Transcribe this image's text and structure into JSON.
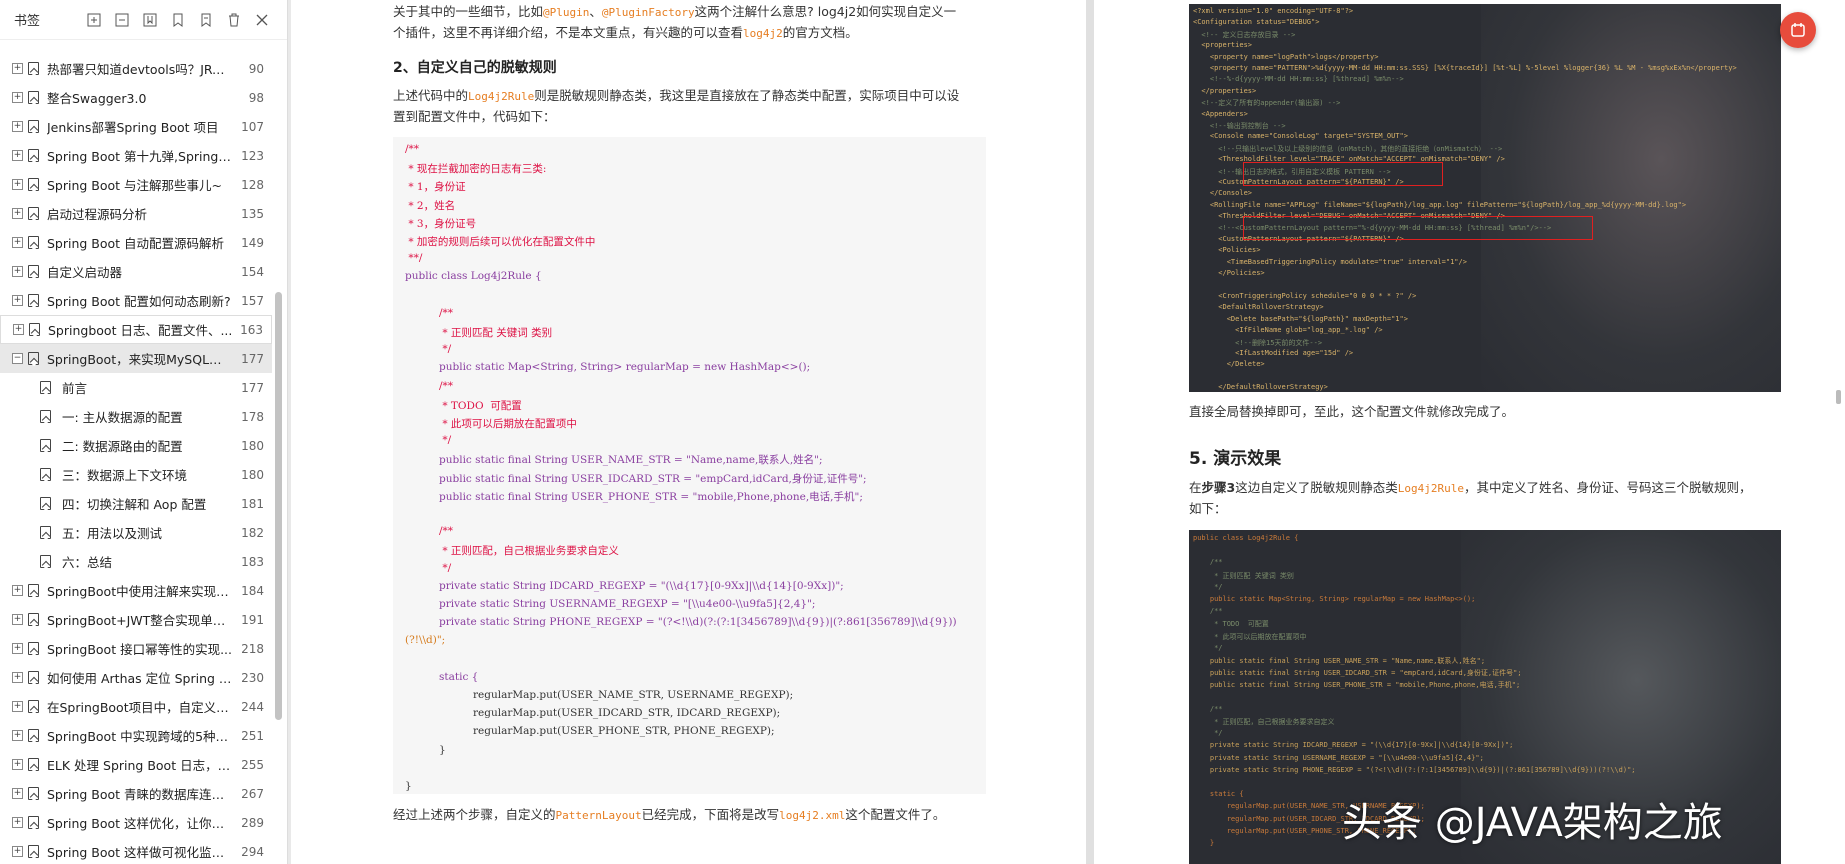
{
  "sidebar": {
    "title": "书签",
    "tools": [
      "expand-all-icon",
      "collapse-all-icon",
      "add-bookmark-icon",
      "bookmark-icon",
      "bookmark-outline-icon",
      "delete-icon",
      "close-icon"
    ],
    "items": [
      {
        "label": "热部署只知道devtools吗？JRebe...",
        "page": "90",
        "level": 0
      },
      {
        "label": "整合Swagger3.0",
        "page": "98",
        "level": 0
      },
      {
        "label": "Jenkins部署Spring Boot 项目",
        "page": "107",
        "level": 0
      },
      {
        "label": "Spring Boot 第十九弹,Spring B...",
        "page": "123",
        "level": 0
      },
      {
        "label": "Spring Boot 与注解那些事儿~",
        "page": "128",
        "level": 0
      },
      {
        "label": "启动过程源码分析",
        "page": "135",
        "level": 0
      },
      {
        "label": "Spring Boot 自动配置源码解析",
        "page": "149",
        "level": 0
      },
      {
        "label": "自定义启动器",
        "page": "154",
        "level": 0
      },
      {
        "label": "Spring Boot 配置如何动态刷新?",
        "page": "157",
        "level": 0
      },
      {
        "label": "Springboot 日志、配置文件、...",
        "page": "163",
        "level": 0
      },
      {
        "label": "SpringBoot，来实现MySQL读...",
        "page": "177",
        "level": 0
      },
      {
        "label": "前言",
        "page": "177",
        "level": 1
      },
      {
        "label": "一: 主从数据源的配置",
        "page": "178",
        "level": 1
      },
      {
        "label": "二: 数据源路由的配置",
        "page": "180",
        "level": 1
      },
      {
        "label": "三：数据源上下文环境",
        "page": "180",
        "level": 1
      },
      {
        "label": "四：切换注解和 Aop 配置",
        "page": "181",
        "level": 1
      },
      {
        "label": "五：用法以及测试",
        "page": "182",
        "level": 1
      },
      {
        "label": "六：总结",
        "page": "183",
        "level": 1
      },
      {
        "label": "SpringBoot中使用注解来实现 R...",
        "page": "184",
        "level": 0
      },
      {
        "label": "SpringBoot+JWT整合实现单点...",
        "page": "191",
        "level": 0
      },
      {
        "label": "SpringBoot 接口幂等性的实现...",
        "page": "218",
        "level": 0
      },
      {
        "label": "如何使用 Arthas 定位 Spring B...",
        "page": "230",
        "level": 0
      },
      {
        "label": "在SpringBoot项目中，自定义注...",
        "page": "244",
        "level": 0
      },
      {
        "label": "SpringBoot 中实现跨域的5种方式",
        "page": "251",
        "level": 0
      },
      {
        "label": "ELK 处理 Spring Boot 日志，妙...",
        "page": "255",
        "level": 0
      },
      {
        "label": "Spring Boot 青睐的数据库连接...",
        "page": "267",
        "level": 0
      },
      {
        "label": "Spring Boot 这样优化，让你的...",
        "page": "289",
        "level": 0
      },
      {
        "label": "Spring Boot 这样做可视化监控...",
        "page": "294",
        "level": 0
      }
    ]
  },
  "doc_left": {
    "p1a": "关于其中的一些细节，比如",
    "p1_hl1": "@Plugin",
    "p1_sep": "、",
    "p1_hl2": "@PluginFactory",
    "p1b": "这两个注解什么意思? log4j2如何实现自定义一",
    "p1c": "个插件，这里不再详细介绍，不是本文重点，有兴趣的可以查看",
    "p1_hl3": "log4j2",
    "p1d": "的官方文档。",
    "h2": "2、自定义自己的脱敏规则",
    "p2a": "上述代码中的",
    "p2_hl": "Log4j2Rule",
    "p2b": "则是脱敏规则静态类，我这里是直接放在了静态类中配置，实际项目中可以设",
    "p2c": "置到配置文件中，代码如下：",
    "code": [
      {
        "t": "/**",
        "c": "c-cm",
        "i": 0
      },
      {
        "t": " * 现在拦截加密的日志有三类:",
        "c": "c-cm",
        "i": 0
      },
      {
        "t": " * 1，身份证",
        "c": "c-cm",
        "i": 0
      },
      {
        "t": " * 2，姓名",
        "c": "c-cm",
        "i": 0
      },
      {
        "t": " * 3，身份证号",
        "c": "c-cm",
        "i": 0
      },
      {
        "t": " * 加密的规则后续可以优化在配置文件中",
        "c": "c-cm",
        "i": 0
      },
      {
        "t": " **/",
        "c": "c-cm",
        "i": 0
      },
      {
        "t": "public class Log4j2Rule {",
        "c": "c-kw",
        "i": 0
      },
      {
        "t": "",
        "c": "",
        "i": 0
      },
      {
        "t": "/**",
        "c": "c-cm",
        "i": 1
      },
      {
        "t": " * 正则匹配 关键词 类别",
        "c": "c-cm",
        "i": 1
      },
      {
        "t": " */",
        "c": "c-cm",
        "i": 1
      },
      {
        "t": "public static Map<String, String> regularMap = new HashMap<>();",
        "c": "c-kw",
        "i": 1
      },
      {
        "t": "/**",
        "c": "c-cm",
        "i": 1
      },
      {
        "t": " * TODO  可配置",
        "c": "c-cm",
        "i": 1
      },
      {
        "t": " * 此项可以后期放在配置项中",
        "c": "c-cm",
        "i": 1
      },
      {
        "t": " */",
        "c": "c-cm",
        "i": 1
      },
      {
        "t": "public static final String USER_NAME_STR = \"Name,name,联系人,姓名\";",
        "c": "c-kw",
        "i": 1
      },
      {
        "t": "public static final String USER_IDCARD_STR = \"empCard,idCard,身份证,证件号\";",
        "c": "c-kw",
        "i": 1
      },
      {
        "t": "public static final String USER_PHONE_STR = \"mobile,Phone,phone,电话,手机\";",
        "c": "c-kw",
        "i": 1
      },
      {
        "t": "",
        "c": "",
        "i": 0
      },
      {
        "t": "/**",
        "c": "c-cm",
        "i": 1
      },
      {
        "t": " * 正则匹配，自己根据业务要求自定义",
        "c": "c-cm",
        "i": 1
      },
      {
        "t": " */",
        "c": "c-cm",
        "i": 1
      },
      {
        "t": "private static String IDCARD_REGEXP = \"(\\\\d{17}[0-9Xx]|\\\\d{14}[0-9Xx])\";",
        "c": "c-kw",
        "i": 1
      },
      {
        "t": "private static String USERNAME_REGEXP = \"[\\\\u4e00-\\\\u9fa5]{2,4}\";",
        "c": "c-kw",
        "i": 1
      },
      {
        "t": "private static String PHONE_REGEXP = \"(?<!\\\\d)(?:(?:1[3456789]\\\\d{9})|(?:861[356789]\\\\d{9}))",
        "c": "c-kw",
        "i": 1
      },
      {
        "t": "(?!\\\\d)\";",
        "c": "c-st",
        "i": 0
      },
      {
        "t": "",
        "c": "",
        "i": 0
      },
      {
        "t": "static {",
        "c": "c-kw",
        "i": 1
      },
      {
        "t": "regularMap.put(USER_NAME_STR, USERNAME_REGEXP);",
        "c": "",
        "i": 2
      },
      {
        "t": "regularMap.put(USER_IDCARD_STR, IDCARD_REGEXP);",
        "c": "",
        "i": 2
      },
      {
        "t": "regularMap.put(USER_PHONE_STR, PHONE_REGEXP);",
        "c": "",
        "i": 2
      },
      {
        "t": "}",
        "c": "",
        "i": 1
      },
      {
        "t": "",
        "c": "",
        "i": 0
      },
      {
        "t": "}",
        "c": "",
        "i": 0
      }
    ],
    "p3a": "经过上述两个步骤，自定义的",
    "p3_hl1": "PatternLayout",
    "p3b": "已经完成，下面将是改写",
    "p3_hl2": "log4j2.xml",
    "p3c": "这个配置文件了。"
  },
  "doc_right": {
    "xml_lines": [
      "<?xml version=\"1.0\" encoding=\"UTF-8\"?>",
      "<Configuration status=\"DEBUG\">",
      "  <!-- 定义日志存放目录 -->",
      "  <properties>",
      "    <property name=\"logPath\">logs</property>",
      "    <property name=\"PATTERN\">%d{yyyy-MM-dd HH:mm:ss.SSS} [%X{traceId}] [%t-%L] %-5level %logger{36} %L %M - %msg%xEx%n</property>",
      "    <!--%-d{yyyy-MM-dd HH:mm:ss} [%thread] %m%n-->",
      "  </properties>",
      "  <!--定义了所有的appender(输出源) -->",
      "  <Appenders>",
      "    <!--输出到控制台 -->",
      "    <Console name=\"ConsoleLog\" target=\"SYSTEM_OUT\">",
      "      <!--只输出level及以上级别的信息（onMatch），其他的直接拒绝（onMismatch） -->",
      "      <ThresholdFilter level=\"TRACE\" onMatch=\"ACCEPT\" onMismatch=\"DENY\" />",
      "      <!--输出日志的格式，引用自定义模板 PATTERN -->",
      "      <CustomPatternLayout pattern=\"${PATTERN}\" />",
      "    </Console>",
      "    <RollingFile name=\"APPLog\" fileName=\"${logPath}/log_app.log\" filePattern=\"${logPath}/log_app_%d{yyyy-MM-dd}.log\">",
      "      <ThresholdFilter level=\"DEBUG\" onMatch=\"ACCEPT\" onMismatch=\"DENY\" />",
      "      <!--<CustomPatternLayout pattern=\"%-d{yyyy-MM-dd HH:mm:ss} [%thread] %m%n\"/>-->",
      "      <CustomPatternLayout pattern=\"${PATTERN}\" />",
      "      <Policies>",
      "        <TimeBasedTriggeringPolicy modulate=\"true\" interval=\"1\"/>",
      "      </Policies>",
      "",
      "      <CronTriggeringPolicy schedule=\"0 0 0 * * ?\" />",
      "      <DefaultRolloverStrategy>",
      "        <Delete basePath=\"${logPath}\" maxDepth=\"1\">",
      "          <IfFileName glob=\"log_app_*.log\" />",
      "          <!--删除15天前的文件-->",
      "          <IfLastModified age=\"15d\" />",
      "        </Delete>",
      "",
      "      </DefaultRolloverStrategy>"
    ],
    "p1": "直接全局替换掉即可，至此，这个配置文件就修改完成了。",
    "h5": "5. 演示效果",
    "p2a": "在",
    "p2_bold": "步骤3",
    "p2b": "这边自定义了脱敏规则静态类",
    "p2_hl": "Log4j2Rule",
    "p2c": "，其中定义了姓名、身份证、号码这三个脱敏规则，",
    "p2d": "如下：",
    "java_lines": [
      "public class Log4j2Rule {",
      "",
      "    /**",
      "     * 正则匹配 关键词 类别",
      "     */",
      "    public static Map<String, String> regularMap = new HashMap<>();",
      "    /**",
      "     * TODO  可配置",
      "     * 此项可以后期放在配置项中",
      "     */",
      "    public static final String USER_NAME_STR = \"Name,name,联系人,姓名\";",
      "    public static final String USER_IDCARD_STR = \"empCard,idCard,身份证,证件号\";",
      "    public static final String USER_PHONE_STR = \"mobile,Phone,phone,电话,手机\";",
      "",
      "    /**",
      "     * 正则匹配，自己根据业务要求自定义",
      "     */",
      "    private static String IDCARD_REGEXP = \"(\\\\d{17}[0-9Xx]|\\\\d{14}[0-9Xx])\";",
      "    private static String USERNAME_REGEXP = \"[\\\\u4e00-\\\\u9fa5]{2,4}\";",
      "    private static String PHONE_REGEXP = \"(?<!\\\\d)(?:(?:1[3456789]\\\\d{9})|(?:861[356789]\\\\d{9}))(?!\\\\d)\";",
      "",
      "    static {",
      "        regularMap.put(USER_NAME_STR, USERNAME_REGEXP);",
      "        regularMap.put(USER_IDCARD_STR, IDCARD_REGEXP);",
      "        regularMap.put(USER_PHONE_STR, PHONE_REGEXP);",
      "    }"
    ],
    "watermark": "头条 @JAVA架构之旅"
  },
  "colors": {
    "accent": "#e74c3c",
    "highlight": "#e67e22",
    "code_bg": "#f6f6f6",
    "dark_bg": "#2b2d33"
  }
}
